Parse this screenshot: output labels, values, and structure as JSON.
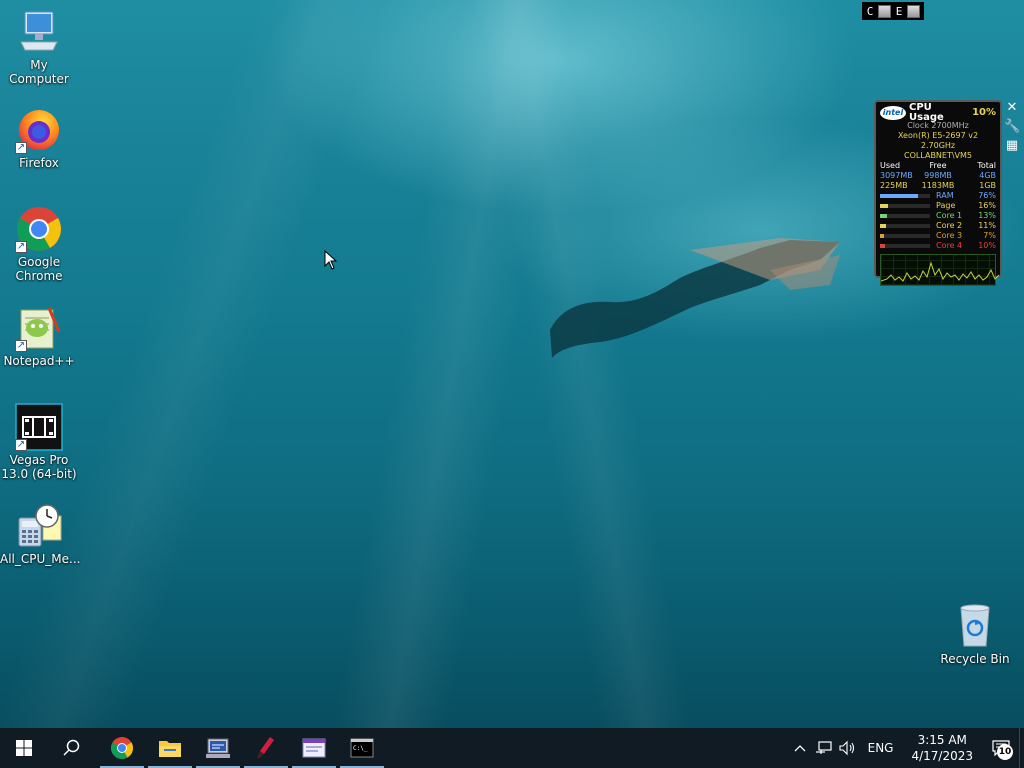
{
  "desktop": {
    "icons": [
      {
        "label": "My Computer",
        "icon": "computer-icon"
      },
      {
        "label": "Firefox",
        "icon": "firefox-icon"
      },
      {
        "label": "Google Chrome",
        "icon": "chrome-icon"
      },
      {
        "label": "Notepad++",
        "icon": "notepadpp-icon"
      },
      {
        "label": "Vegas Pro 13.0 (64-bit)",
        "icon": "vegas-icon"
      },
      {
        "label": "All_CPU_Me...",
        "icon": "cpu-meter-icon"
      },
      {
        "label": "Recycle Bin",
        "icon": "recycle-bin-icon"
      }
    ]
  },
  "mini_bar": {
    "c": "C",
    "e": "E"
  },
  "cpu_gadget": {
    "brand": "intel",
    "title": "CPU Usage",
    "usage": "10%",
    "clock": "Clock 2700MHz",
    "cpu_model": "Xeon(R) E5-2697 v2 2.70GHz",
    "host": "COLLABNET\\VM5",
    "headers": {
      "used": "Used",
      "free": "Free",
      "total": "Total"
    },
    "mem_rows": [
      {
        "used": "3097MB",
        "free": "998MB",
        "total": "4GB"
      },
      {
        "used": "225MB",
        "free": "1183MB",
        "total": "1GB"
      }
    ],
    "meters": [
      {
        "label": "RAM",
        "value": "76%",
        "fill": 0.76,
        "color": "#6fa8ff"
      },
      {
        "label": "Page",
        "value": "16%",
        "fill": 0.16,
        "color": "#e8d35a"
      },
      {
        "label": "Core 1",
        "value": "13%",
        "fill": 0.13,
        "color": "#7ad07a"
      },
      {
        "label": "Core 2",
        "value": "11%",
        "fill": 0.11,
        "color": "#e8d35a"
      },
      {
        "label": "Core 3",
        "value": "7%",
        "fill": 0.07,
        "color": "#e0a030"
      },
      {
        "label": "Core 4",
        "value": "10%",
        "fill": 0.1,
        "color": "#e04040"
      }
    ]
  },
  "taskbar": {
    "apps": [
      "start-icon",
      "search-icon",
      "chrome-icon",
      "file-explorer-icon",
      "network-app-icon",
      "paint-icon",
      "window-app-icon",
      "terminal-icon"
    ],
    "tray": {
      "language": "ENG",
      "time": "3:15 AM",
      "date": "4/17/2023",
      "notification_count": "10"
    }
  },
  "colors": {
    "taskbar_bg": "#101b24",
    "accent": "#8ab4d8"
  }
}
